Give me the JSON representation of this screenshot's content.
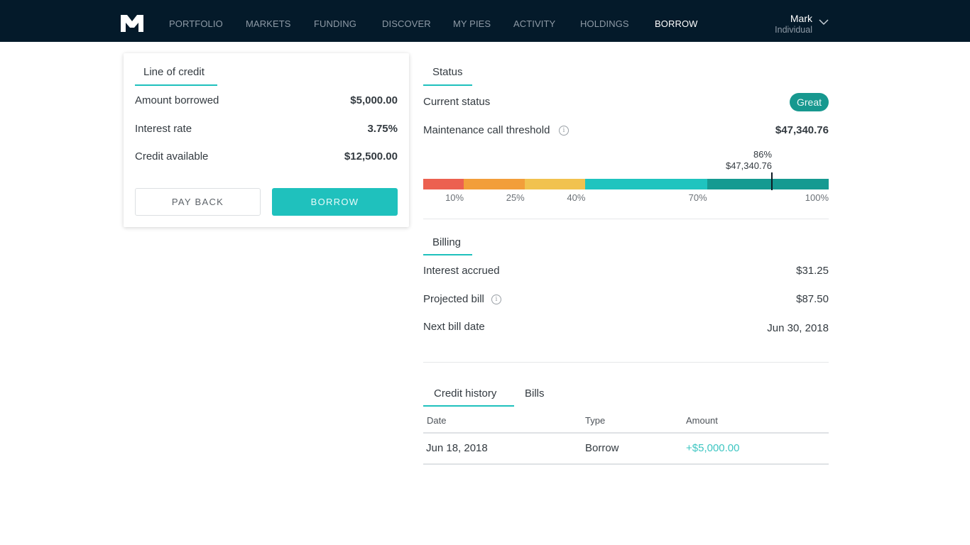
{
  "nav": {
    "logo": "M1",
    "items": [
      {
        "label": "PORTFOLIO",
        "active": false
      },
      {
        "label": "MARKETS",
        "active": false
      },
      {
        "label": "FUNDING",
        "active": false
      },
      {
        "label": "DISCOVER",
        "active": false
      },
      {
        "label": "MY PIES",
        "active": false
      },
      {
        "label": "ACTIVITY",
        "active": false
      },
      {
        "label": "HOLDINGS",
        "active": false
      },
      {
        "label": "BORROW",
        "active": true
      }
    ],
    "user": {
      "name": "Mark",
      "account_type": "Individual",
      "menu_icon": "chevron-down-icon"
    }
  },
  "line_of_credit": {
    "title": "Line of credit",
    "rows": [
      {
        "label": "Amount borrowed",
        "value": "$5,000.00"
      },
      {
        "label": "Interest rate",
        "value": "3.75%"
      },
      {
        "label": "Credit available",
        "value": "$12,500.00"
      }
    ],
    "pay_back_label": "PAY BACK",
    "borrow_label": "BORROW"
  },
  "status": {
    "title": "Status",
    "current_status_label": "Current status",
    "current_status_value": "Great",
    "threshold_label": "Maintenance call threshold",
    "threshold_value": "$47,340.76",
    "gauge": {
      "segments": [
        {
          "from": 0,
          "to": 10,
          "color": "#ec6050"
        },
        {
          "from": 10,
          "to": 25,
          "color": "#f29e3a"
        },
        {
          "from": 25,
          "to": 40,
          "color": "#f1c24f"
        },
        {
          "from": 40,
          "to": 70,
          "color": "#1fc4bf"
        },
        {
          "from": 70,
          "to": 100,
          "color": "#159a91"
        }
      ],
      "tick_labels": [
        {
          "pct": 10,
          "label": "10%"
        },
        {
          "pct": 25,
          "label": "25%"
        },
        {
          "pct": 40,
          "label": "40%"
        },
        {
          "pct": 70,
          "label": "70%"
        },
        {
          "pct": 100,
          "label": "100%"
        }
      ],
      "marker_percent": 86,
      "marker_pct_label": "86%",
      "marker_value_label": "$47,340.76"
    }
  },
  "billing": {
    "title": "Billing",
    "rows": [
      {
        "label": "Interest accrued",
        "value": "$31.25",
        "info": false
      },
      {
        "label": "Projected bill",
        "value": "$87.50",
        "info": true
      },
      {
        "label": "Next bill date",
        "value": "Jun 30, 2018",
        "info": false
      }
    ]
  },
  "history": {
    "tabs": [
      {
        "label": "Credit history",
        "active": true
      },
      {
        "label": "Bills",
        "active": false
      }
    ],
    "columns": [
      "Date",
      "Type",
      "Amount"
    ],
    "rows": [
      {
        "date": "Jun 18, 2018",
        "type": "Borrow",
        "amount": "+$5,000.00"
      }
    ]
  },
  "colors": {
    "accent": "#1fc1bd",
    "nav_bg": "#041a2a",
    "status_great": "#17988f"
  }
}
